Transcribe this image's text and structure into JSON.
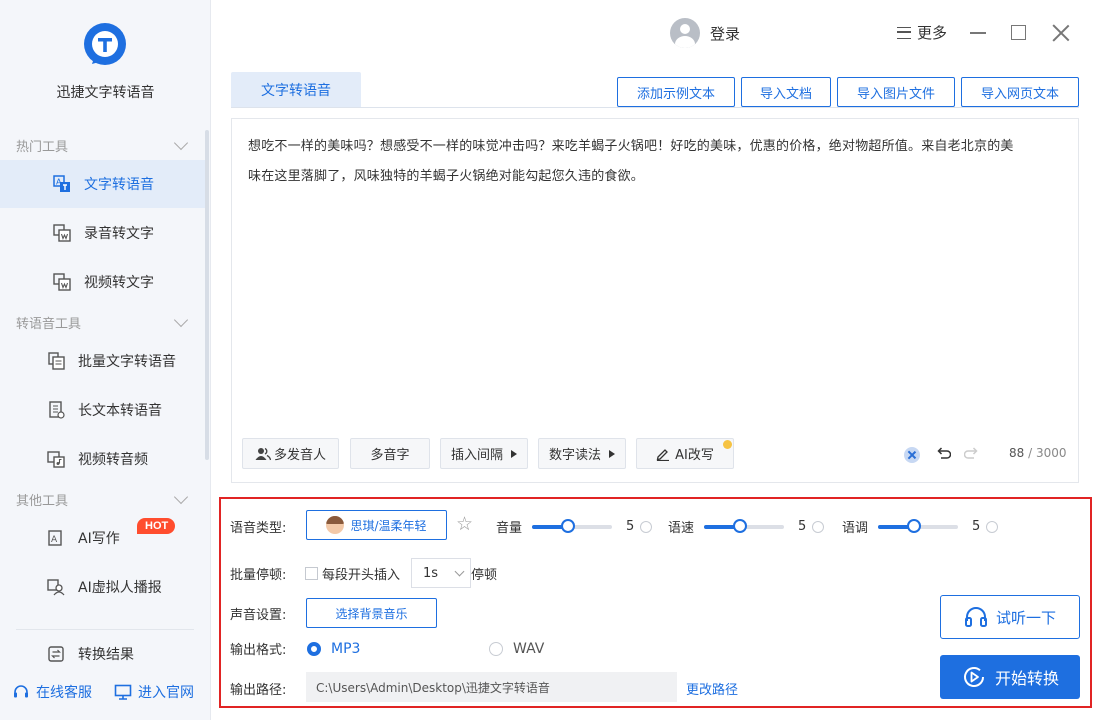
{
  "app": {
    "name": "迅捷文字转语音",
    "brand_color": "#1e6fe0",
    "highlight_color": "#e12424"
  },
  "sidebar": {
    "groups": [
      {
        "title": "热门工具",
        "items": [
          {
            "label": "文字转语音",
            "icon": "text-to-speech-icon",
            "active": true
          },
          {
            "label": "录音转文字",
            "icon": "audio-to-text-icon"
          },
          {
            "label": "视频转文字",
            "icon": "video-to-text-icon"
          }
        ]
      },
      {
        "title": "转语音工具",
        "items": [
          {
            "label": "批量文字转语音",
            "icon": "batch-convert-icon"
          },
          {
            "label": "长文本转语音",
            "icon": "long-text-icon"
          },
          {
            "label": "视频转音频",
            "icon": "video-audio-icon"
          }
        ]
      },
      {
        "title": "其他工具",
        "items": [
          {
            "label": "AI写作",
            "icon": "ai-writing-icon",
            "badge": "HOT"
          },
          {
            "label": "AI虚拟人播报",
            "icon": "ai-avatar-icon"
          }
        ]
      }
    ],
    "result": {
      "label": "转换结果",
      "icon": "result-icon"
    },
    "support": "在线客服",
    "website": "进入官网"
  },
  "titlebar": {
    "login": "登录",
    "more": "更多"
  },
  "tabs": [
    {
      "label": "文字转语音",
      "active": true
    }
  ],
  "import_buttons": [
    "添加示例文本",
    "导入文档",
    "导入图片文件",
    "导入网页文本"
  ],
  "editor": {
    "line1": "想吃不一样的美味吗？想感受不一样的味觉冲击吗？来吃羊蝎子火锅吧！好吃的美味，优惠的价格，绝对物超所值。来自老北京的美",
    "line2": "味在这里落脚了，风味独特的羊蝎子火锅绝对能勾起您久违的食欲。",
    "count": "88",
    "max": "/ 3000"
  },
  "editor_tools": {
    "multi_speaker": "多发音人",
    "polyphone": "多音字",
    "insert_pause": "插入间隔",
    "number_reading": "数字读法",
    "ai_rewrite": "AI改写"
  },
  "settings": {
    "voice_type_label": "语音类型:",
    "voice": "思琪/温柔年轻",
    "volume": {
      "label": "音量",
      "value": 5,
      "fraction": 0.45
    },
    "speed": {
      "label": "语速",
      "value": 5,
      "fraction": 0.45
    },
    "pitch": {
      "label": "语调",
      "value": 5,
      "fraction": 0.45
    },
    "batch_pause_label": "批量停顿:",
    "batch_pause_text": "每段开头插入",
    "batch_pause_value": "1s",
    "batch_pause_suffix": "停顿",
    "sound_label": "声音设置:",
    "bgm_button": "选择背景音乐",
    "format_label": "输出格式:",
    "format_options": [
      "MP3",
      "WAV"
    ],
    "format_selected": "MP3",
    "path_label": "输出路径:",
    "path": "C:\\Users\\Admin\\Desktop\\迅捷文字转语音",
    "change_path": "更改路径",
    "listen_button": "试听一下",
    "start_button": "开始转换"
  }
}
